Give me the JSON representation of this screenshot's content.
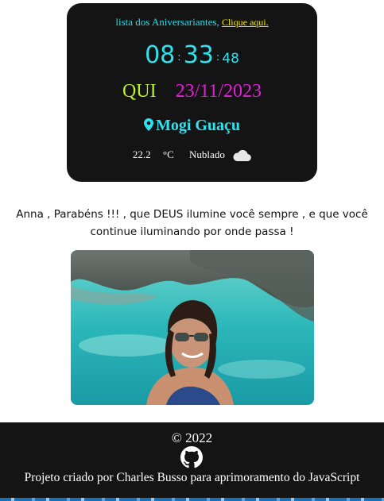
{
  "header": {
    "list_text": "lista dos Aniversariantes,",
    "list_link": "Clique aqui."
  },
  "clock": {
    "hours": "08",
    "separator": ":",
    "minutes": "33",
    "seconds": "48",
    "weekday": "QUI",
    "date": "23/11/2023"
  },
  "location": {
    "city": "Mogi Guaçu",
    "icon": "map-pin-icon"
  },
  "weather": {
    "temperature": "22.2",
    "unit": "°C",
    "condition": "Nublado",
    "icon": "cloud-icon"
  },
  "message": {
    "text": "Anna , Parabéns !!! , que DEUS ilumine você sempre , e que você continue iluminando por onde passa !"
  },
  "footer": {
    "copyright": "© 2022",
    "github_icon": "github-icon",
    "credit": "Projeto criado por Charles Busso para aprimoramento do JavaScript"
  },
  "colors": {
    "card_bg": "#141414",
    "cyan": "#2ee2ee",
    "lime": "#b9f02b",
    "magenta": "#e31ed8",
    "link_yellow": "#f2e600"
  }
}
